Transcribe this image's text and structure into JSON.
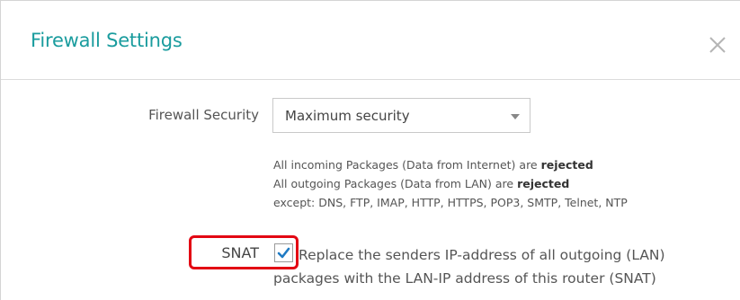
{
  "dialog": {
    "title": "Firewall Settings",
    "close_icon": "close-icon"
  },
  "firewall_security": {
    "label": "Firewall Security",
    "selected_option": "Maximum security",
    "caret_icon": "caret-down-icon"
  },
  "info": {
    "line1_prefix": "All incoming Packages (Data from Internet) are ",
    "line1_bold": "rejected",
    "line2_prefix": "All outgoing Packages (Data from LAN) are ",
    "line2_bold": "rejected",
    "line3": "except: DNS, FTP, IMAP, HTTP, HTTPS, POP3, SMTP, Telnet, NTP"
  },
  "snat": {
    "label": "SNAT",
    "checked": true,
    "description": "Replace the senders IP-address of all outgoing (LAN) packages with the LAN-IP address of this router (SNAT)"
  },
  "colors": {
    "title": "#1a9c9e",
    "checkmark": "#1f7bc4",
    "highlight": "#e30613"
  }
}
